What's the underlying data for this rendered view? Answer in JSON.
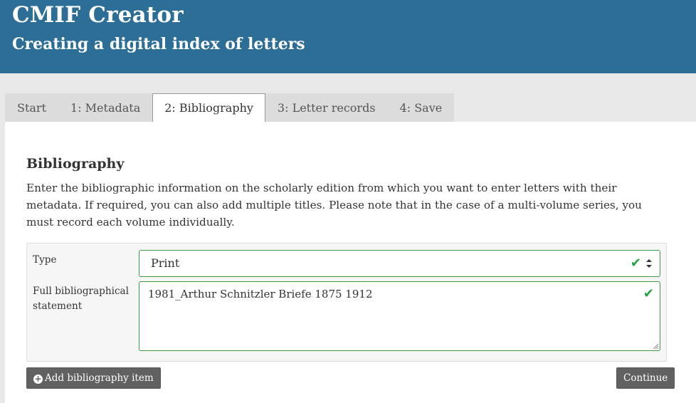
{
  "header": {
    "title": "CMIF Creator",
    "subtitle": "Creating a digital index of letters"
  },
  "tabs": [
    {
      "label": "Start"
    },
    {
      "label": "1: Metadata"
    },
    {
      "label": "2: Bibliography",
      "active": true
    },
    {
      "label": "3: Letter records"
    },
    {
      "label": "4: Save"
    }
  ],
  "section": {
    "title": "Bibliography",
    "intro": "Enter the bibliographic information on the scholarly edition from which you want to enter letters with their metadata. If required, you can also add multiple titles. Please note that in the case of a multi-volume series, you must record each volume individually."
  },
  "form": {
    "type_label": "Type",
    "type_value": "Print",
    "full_label": "Full bibliographical statement",
    "full_value": "1981_Arthur Schnitzler Briefe 1875 1912",
    "check_glyph": "✔"
  },
  "buttons": {
    "add_icon": "+",
    "add_label": "Add bibliography item",
    "continue_label": "Continue"
  },
  "colors": {
    "header_bg": "#2c6e96",
    "valid_green": "#27a243",
    "button_bg": "#616161"
  }
}
